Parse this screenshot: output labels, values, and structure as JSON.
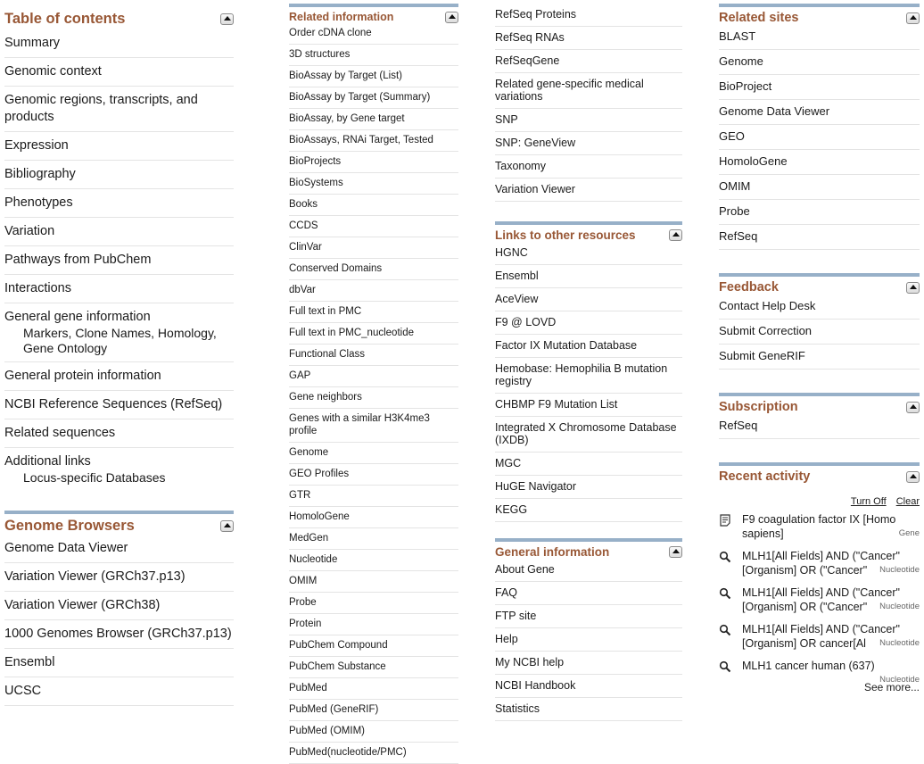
{
  "toc": {
    "title": "Table of contents",
    "items": [
      {
        "label": "Summary"
      },
      {
        "label": "Genomic context"
      },
      {
        "label": "Genomic regions, transcripts, and products"
      },
      {
        "label": "Expression"
      },
      {
        "label": "Bibliography"
      },
      {
        "label": "Phenotypes"
      },
      {
        "label": "Variation"
      },
      {
        "label": "Pathways from PubChem"
      },
      {
        "label": "Interactions"
      },
      {
        "label": "General gene information",
        "sub": "Markers, Clone Names, Homology, Gene Ontology"
      },
      {
        "label": "General protein information"
      },
      {
        "label": "NCBI Reference Sequences (RefSeq)"
      },
      {
        "label": "Related sequences"
      },
      {
        "label": "Additional links",
        "sub": "Locus-specific Databases"
      }
    ]
  },
  "genome_browsers": {
    "title": "Genome Browsers",
    "items": [
      "Genome Data Viewer",
      "Variation Viewer (GRCh37.p13)",
      "Variation Viewer (GRCh38)",
      "1000 Genomes Browser (GRCh37.p13)",
      "Ensembl",
      "UCSC"
    ]
  },
  "related_information": {
    "title": "Related information",
    "items": [
      "Order cDNA clone",
      "3D structures",
      "BioAssay by Target (List)",
      "BioAssay by Target (Summary)",
      "BioAssay, by Gene target",
      "BioAssays, RNAi Target, Tested",
      "BioProjects",
      "BioSystems",
      "Books",
      "CCDS",
      "ClinVar",
      "Conserved Domains",
      "dbVar",
      "Full text in PMC",
      "Full text in PMC_nucleotide",
      "Functional Class",
      "GAP",
      "Gene neighbors",
      "Genes with a similar H3K4me3 profile",
      "Genome",
      "GEO Profiles",
      "GTR",
      "HomoloGene",
      "MedGen",
      "Nucleotide",
      "OMIM",
      "Probe",
      "Protein",
      "PubChem Compound",
      "PubChem Substance",
      "PubMed",
      "PubMed (GeneRIF)",
      "PubMed (OMIM)",
      "PubMed(nucleotide/PMC)"
    ]
  },
  "related_information_cont": {
    "items": [
      "RefSeq Proteins",
      "RefSeq RNAs",
      "RefSeqGene",
      "Related gene-specific medical variations",
      "SNP",
      "SNP: GeneView",
      "Taxonomy",
      "Variation Viewer"
    ]
  },
  "links_other": {
    "title": "Links to other resources",
    "items": [
      "HGNC",
      "Ensembl",
      "AceView",
      "F9 @ LOVD",
      "Factor IX Mutation Database",
      "Hemobase: Hemophilia B mutation registry",
      "CHBMP F9 Mutation List",
      "Integrated X Chromosome Database (IXDB)",
      "MGC",
      "HuGE Navigator",
      "KEGG"
    ]
  },
  "general_information": {
    "title": "General information",
    "items": [
      "About Gene",
      "FAQ",
      "FTP site",
      "Help",
      "My NCBI help",
      "NCBI Handbook",
      "Statistics"
    ]
  },
  "related_sites": {
    "title": "Related sites",
    "items": [
      "BLAST",
      "Genome",
      "BioProject",
      "Genome Data Viewer",
      "GEO",
      "HomoloGene",
      "OMIM",
      "Probe",
      "RefSeq"
    ]
  },
  "feedback": {
    "title": "Feedback",
    "items": [
      "Contact Help Desk",
      "Submit Correction",
      "Submit GeneRIF"
    ]
  },
  "subscription": {
    "title": "Subscription",
    "items": [
      "RefSeq"
    ]
  },
  "recent_activity": {
    "title": "Recent activity",
    "turn_off": "Turn Off",
    "clear": "Clear",
    "items": [
      {
        "icon": "document-icon",
        "text": "F9 coagulation factor IX [Homo sapiens]",
        "db": "Gene"
      },
      {
        "icon": "search-icon",
        "text": "MLH1[All Fields] AND (\"Cancer\" [Organism] OR (\"Cancer\"",
        "db": "Nucleotide"
      },
      {
        "icon": "search-icon",
        "text": "MLH1[All Fields] AND (\"Cancer\" [Organism] OR (\"Cancer\"",
        "db": "Nucleotide"
      },
      {
        "icon": "search-icon",
        "text": "MLH1[All Fields] AND (\"Cancer\" [Organism] OR cancer[Al",
        "db": "Nucleotide"
      },
      {
        "icon": "search-icon",
        "text": "MLH1 cancer human (637)",
        "db": "Nucleotide"
      }
    ],
    "see_more": "See more..."
  }
}
